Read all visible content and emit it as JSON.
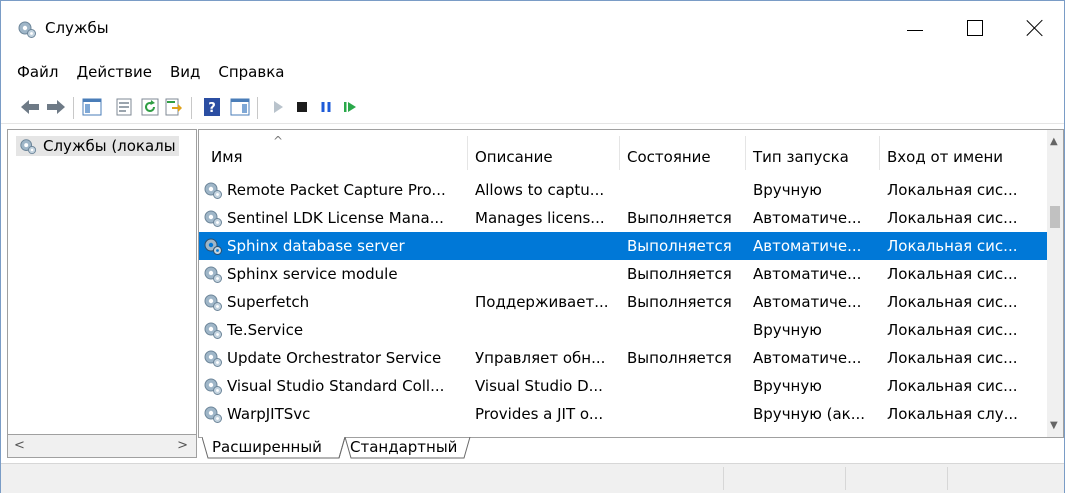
{
  "window": {
    "title": "Службы",
    "icon": "gears-icon"
  },
  "menu": [
    "Файл",
    "Действие",
    "Вид",
    "Справка"
  ],
  "toolbar": {
    "buttons": [
      "back-arrow-icon",
      "forward-arrow-icon",
      "show-hide-console-tree-icon",
      "properties-icon",
      "refresh-icon",
      "export-list-icon",
      "help-icon",
      "show-hide-action-pane-icon",
      "start-service-icon",
      "stop-service-icon",
      "pause-service-icon",
      "restart-service-icon"
    ]
  },
  "tree": {
    "item": "Службы (локалы"
  },
  "list": {
    "columns": [
      "Имя",
      "Описание",
      "Состояние",
      "Тип запуска",
      "Вход от имени"
    ],
    "rows": [
      {
        "name": "Remote Packet Capture Pro...",
        "description": "Allows to captu...",
        "state": "",
        "startup": "Вручную",
        "logon": "Локальная сис..."
      },
      {
        "name": "Sentinel LDK License Mana...",
        "description": "Manages licens...",
        "state": "Выполняется",
        "startup": "Автоматиче...",
        "logon": "Локальная сис..."
      },
      {
        "name": "Sphinx database server",
        "description": "",
        "state": "Выполняется",
        "startup": "Автоматиче...",
        "logon": "Локальная сис...",
        "selected": true
      },
      {
        "name": "Sphinx service module",
        "description": "",
        "state": "Выполняется",
        "startup": "Автоматиче...",
        "logon": "Локальная сис..."
      },
      {
        "name": "Superfetch",
        "description": "Поддерживает...",
        "state": "Выполняется",
        "startup": "Автоматиче...",
        "logon": "Локальная сис..."
      },
      {
        "name": "Te.Service",
        "description": "",
        "state": "",
        "startup": "Вручную",
        "logon": "Локальная сис..."
      },
      {
        "name": "Update Orchestrator Service",
        "description": "Управляет обн...",
        "state": "Выполняется",
        "startup": "Автоматиче...",
        "logon": "Локальная сис..."
      },
      {
        "name": "Visual Studio Standard Coll...",
        "description": "Visual Studio D...",
        "state": "",
        "startup": "Вручную",
        "logon": "Локальная сис..."
      },
      {
        "name": "WarpJITSvc",
        "description": "Provides a JIT o...",
        "state": "",
        "startup": "Вручную (ак...",
        "logon": "Локальная слу..."
      }
    ]
  },
  "tabs": [
    "Расширенный",
    "Стандартный"
  ],
  "colors": {
    "selection": "#0078d7",
    "play_green": "#2aa84a",
    "pause_blue": "#1e5bd8"
  }
}
